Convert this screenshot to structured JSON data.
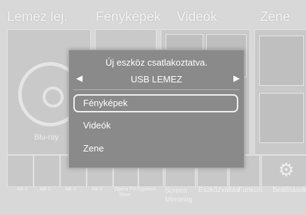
{
  "top_menu": [
    "Lemez lej.",
    "Fényképek",
    "Videók",
    "Zene"
  ],
  "disc_label": "Blu-ray",
  "apps": [
    "Alk 1",
    "Alk 2",
    "Alk 3",
    "Alk 4",
    "Opera TV Store",
    "Egyebek"
  ],
  "settings_items": [
    "Screen Mirroring",
    "Eszközváltás",
    "Funkció",
    "Beállítások"
  ],
  "dialog": {
    "title": "Új eszköz csatlakoztatva.",
    "device": "USB LEMEZ",
    "options": [
      "Fényképek",
      "Videók",
      "Zene"
    ],
    "selected_index": 0
  }
}
